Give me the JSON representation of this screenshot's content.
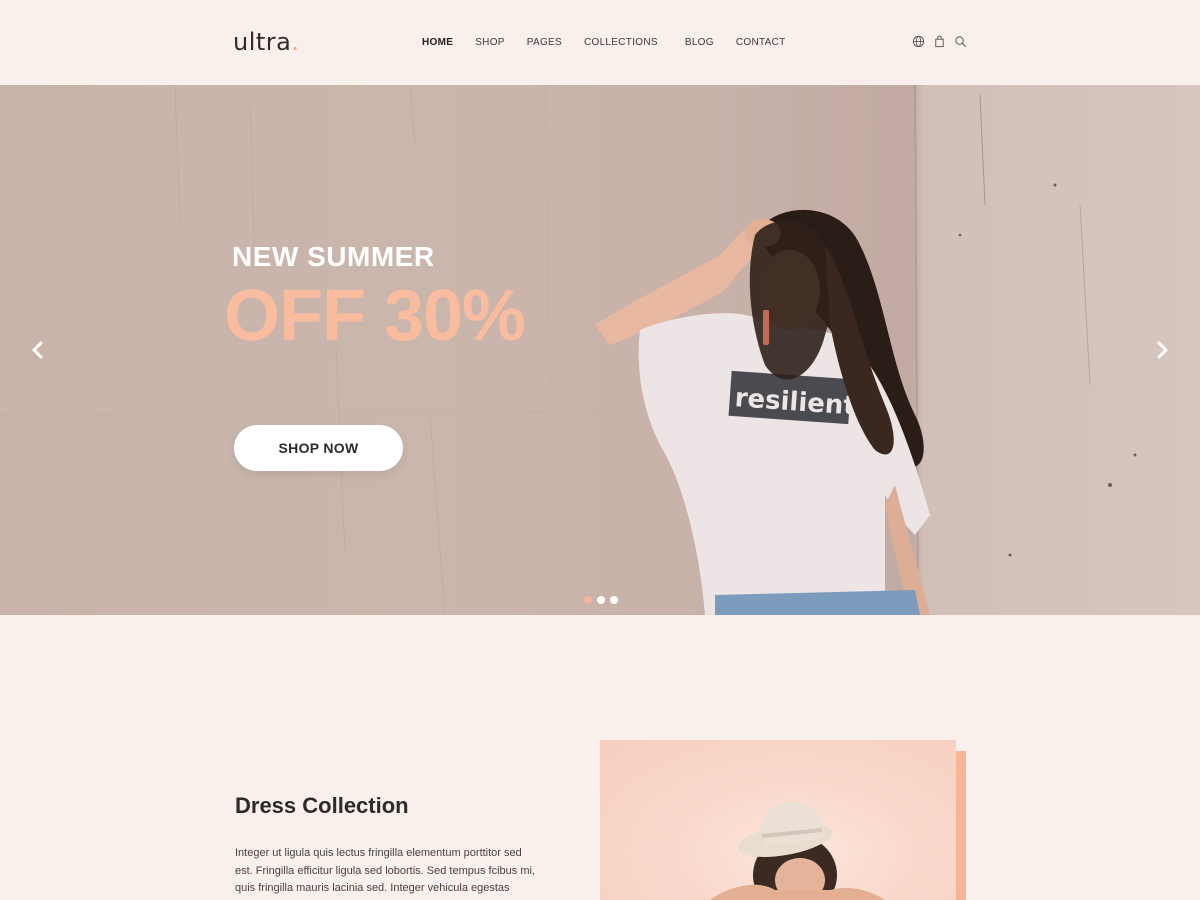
{
  "brand": {
    "name": "ultra",
    "dot": ".",
    "accent_color": "#f3a98a"
  },
  "nav": {
    "items": [
      {
        "label": "HOME",
        "active": true
      },
      {
        "label": "SHOP",
        "active": false
      },
      {
        "label": "PAGES",
        "active": false
      },
      {
        "label": "COLLECTIONS",
        "active": false
      },
      {
        "label": "BLOG",
        "active": false
      },
      {
        "label": "CONTACT",
        "active": false
      }
    ],
    "icons": [
      "globe-icon",
      "shopping-bag-icon",
      "search-icon"
    ]
  },
  "hero": {
    "subtitle": "NEW SUMMER",
    "title": "OFF 30%",
    "title_color": "#f9bc9e",
    "button_label": "SHOP NOW",
    "tshirt_text": "resilient",
    "slides": {
      "count": 3,
      "active": 1
    }
  },
  "collection": {
    "title": "Dress Collection",
    "text": "Integer ut ligula quis lectus fringilla elementum porttitor sed est. Fringilla efficitur ligula sed lobortis. Sed tempus fcibus mi, quis fringilla mauris lacinia sed. Integer vehicula egestas"
  }
}
